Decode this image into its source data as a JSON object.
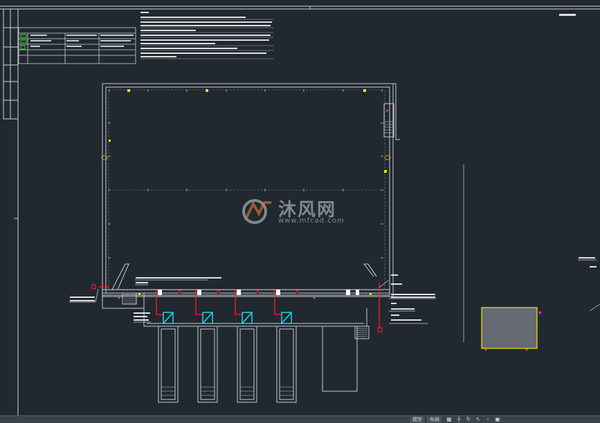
{
  "watermark": {
    "title": "沐风网",
    "url": "www.mfcad.com"
  },
  "status_bar": {
    "tabs": [
      "模型",
      "布局"
    ],
    "icons": [
      "grid-icon",
      "snap-icon",
      "rotate-icon",
      "cursor-icon",
      "arrow-icon",
      "window-icon"
    ]
  },
  "colors": {
    "background": "#212830",
    "line": "#c8ccd0",
    "green": "#2bd62b",
    "yellow": "#ffe000",
    "red": "#ff2020",
    "cyan": "#20e0f0",
    "magenta": "#ff30d0"
  }
}
